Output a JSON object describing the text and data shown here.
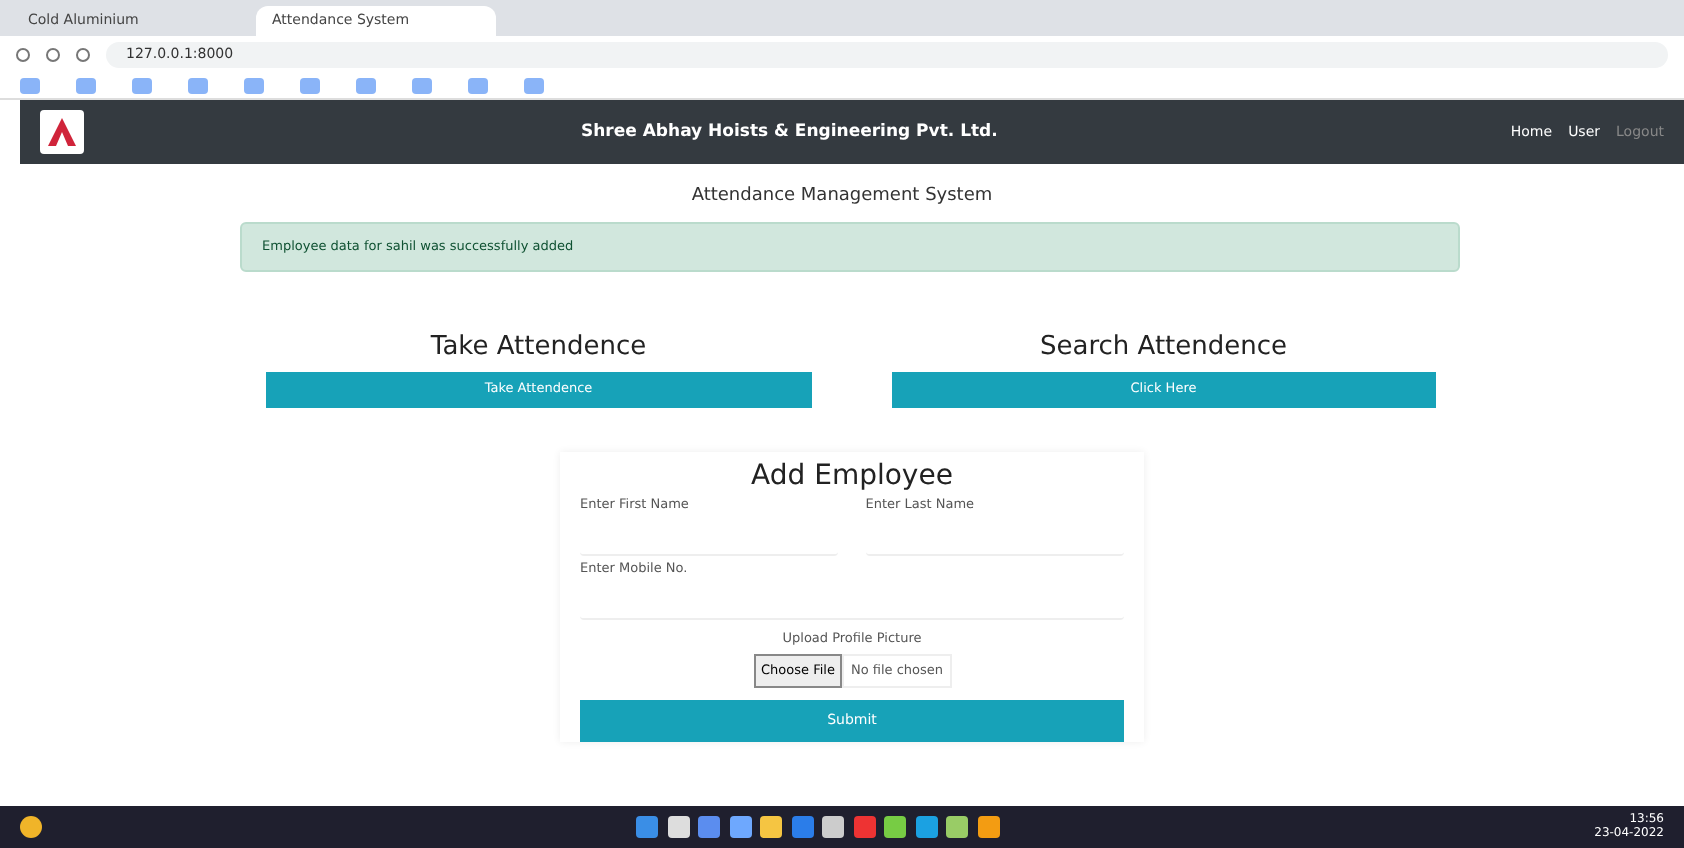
{
  "browser": {
    "tabs": [
      {
        "title": "Cold Aluminium",
        "selected": false
      },
      {
        "title": "Attendance System",
        "selected": true
      }
    ],
    "address": "127.0.0.1:8000"
  },
  "navbar": {
    "brand": "Shree Abhay Hoists & Engineering Pvt. Ltd.",
    "links": [
      {
        "label": "Home",
        "disabled": false
      },
      {
        "label": "User",
        "disabled": false
      },
      {
        "label": "Logout",
        "disabled": true
      }
    ]
  },
  "page_title": "Attendance Management System",
  "alert": "Employee data for sahil was successfully added",
  "actions": [
    {
      "heading": "Take Attendence",
      "button": "Take Attendence"
    },
    {
      "heading": "Search Attendence",
      "button": "Click Here"
    }
  ],
  "form": {
    "title": "Add Employee",
    "first_name_label": "Enter First Name",
    "last_name_label": "Enter Last Name",
    "mobile_label": "Enter Mobile No.",
    "picture_label": "Upload Profile Picture",
    "file_button": "Choose File",
    "file_status": "No file chosen",
    "submit": "Submit"
  },
  "taskbar": {
    "time": "13:56",
    "date": "23-04-2022"
  }
}
